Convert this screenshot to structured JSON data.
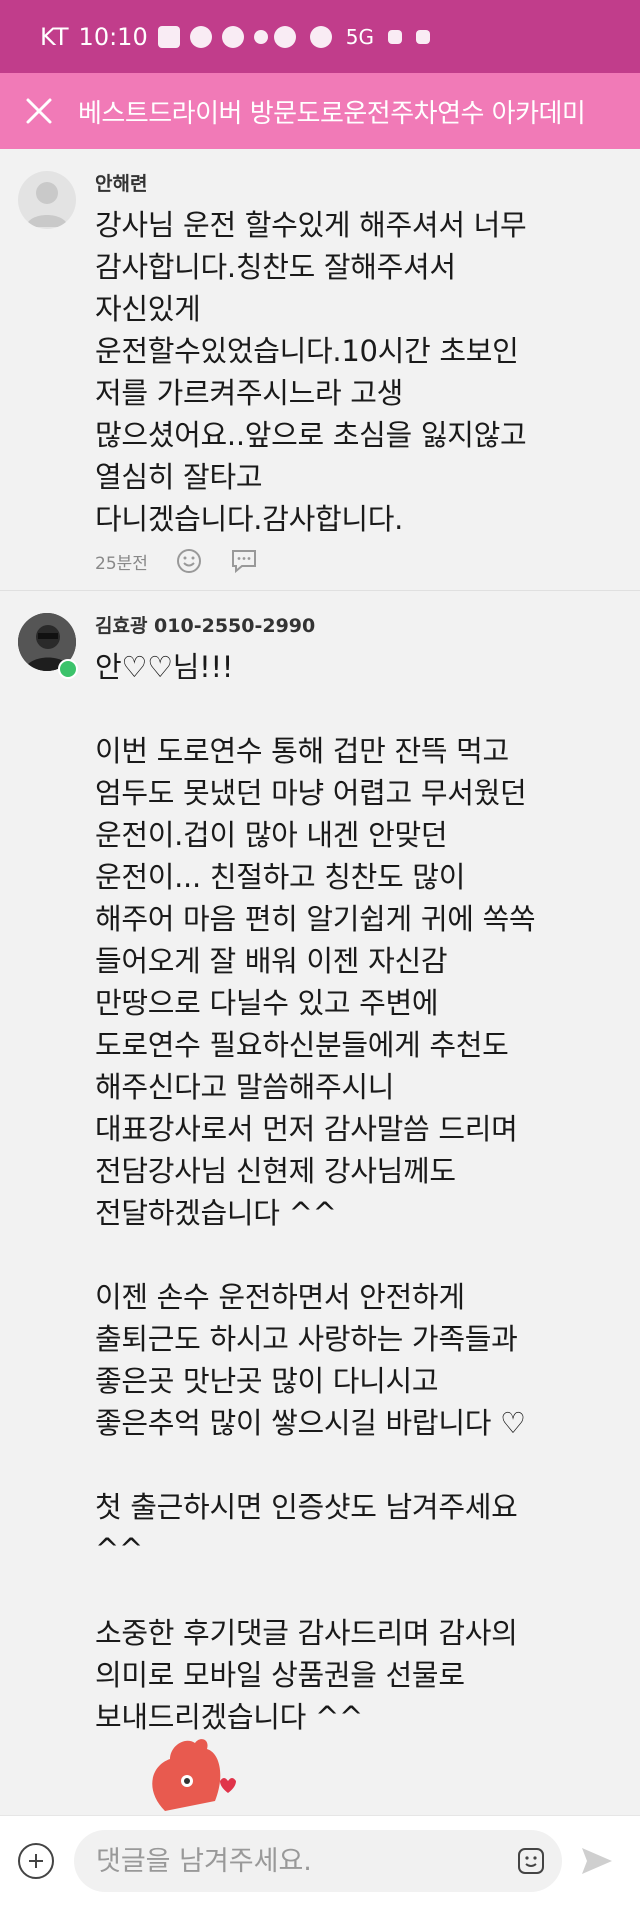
{
  "status_bar": {
    "carrier": "KT",
    "time": "10:10",
    "network": "5G"
  },
  "header": {
    "title": "베스트드라이버 방문도로운전주차연수 아카데미"
  },
  "comments": [
    {
      "author": "안해련",
      "text": "강사님 운전 할수있게 해주셔서 너무\n감사합니다.칭찬도 잘해주셔서\n자신있게\n운전할수있었습니다.10시간 초보인\n저를 가르켜주시느라 고생\n많으셨어요..앞으로 초심을 잃지않고\n열심히 잘타고\n다니겠습니다.감사합니다.",
      "time": "25분전"
    },
    {
      "author": "김효광 010-2550-2990",
      "text": "안♡♡님!!!\n\n이번 도로연수 통해 겁만 잔뜩 먹고\n엄두도 못냈던 마냥 어렵고 무서웠던\n운전이.겁이 많아 내겐 안맞던\n운전이... 친절하고 칭찬도 많이\n해주어 마음 편히 알기쉽게 귀에 쏙쏙\n들어오게 잘 배워 이젠 자신감\n만땅으로 다닐수 있고 주변에\n도로연수 필요하신분들에게 추천도\n해주신다고 말씀해주시니\n대표강사로서 먼저 감사말씀 드리며\n전담강사님 신현제 강사님께도\n전달하겠습니다 ^^\n\n이젠 손수 운전하면서 안전하게\n출퇴근도 하시고 사랑하는 가족들과\n좋은곳 맛난곳 많이 다니시고\n좋은추억 많이 쌓으시길 바랍니다 ♡\n\n첫 출근하시면 인증샷도 남겨주세요\n^^\n\n소중한 후기댓글 감사드리며 감사의\n의미로 모바일 상품권을 선물로\n보내드리겠습니다 ^^"
    }
  ],
  "input": {
    "placeholder": "댓글을 남겨주세요."
  },
  "colors": {
    "status_bar": "#c13d8b",
    "header": "#f17ab7"
  }
}
